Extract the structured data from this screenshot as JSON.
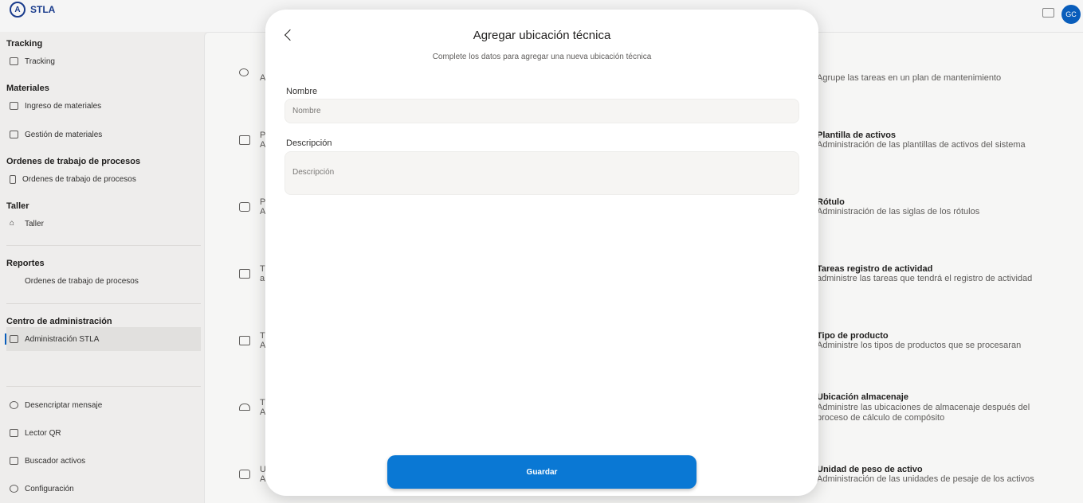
{
  "brand": {
    "logo": "A",
    "name": "STLA"
  },
  "header": {
    "avatar_initials": "GC"
  },
  "sidebar": {
    "sections": [
      {
        "title": "Tracking",
        "items": [
          {
            "label": "Tracking"
          }
        ]
      },
      {
        "title": "Materiales",
        "items": [
          {
            "label": "Ingreso de materiales"
          },
          {
            "label": "Gestión de materiales"
          }
        ]
      },
      {
        "title": "Ordenes de trabajo de procesos",
        "items": [
          {
            "label": "Ordenes de trabajo de procesos"
          }
        ]
      },
      {
        "title": "Taller",
        "items": [
          {
            "label": "Taller"
          }
        ]
      },
      {
        "title": "Reportes",
        "items": [
          {
            "label": "Ordenes de trabajo de procesos"
          }
        ]
      },
      {
        "title": "Centro de administración",
        "items": [
          {
            "label": "Administración STLA"
          }
        ]
      }
    ],
    "bottom_items": [
      {
        "label": "Desencriptar mensaje"
      },
      {
        "label": "Lector QR"
      },
      {
        "label": "Buscador activos"
      },
      {
        "label": "Configuración"
      }
    ]
  },
  "main": {
    "left_letters": [
      "A",
      "P",
      "P",
      "T",
      "T",
      "T",
      "U"
    ],
    "left_sub_letters": [
      "A",
      "A",
      "a",
      "A",
      "A",
      "A"
    ],
    "cards": [
      {
        "title": "",
        "desc": "Agrupe las tareas en un plan de mantenimiento"
      },
      {
        "title": "Plantilla de activos",
        "desc": "Administración de las plantillas de activos del sistema"
      },
      {
        "title": "Rótulo",
        "desc": "Administración de las siglas de los rótulos"
      },
      {
        "title": "Tareas registro de actividad",
        "desc": "administre las tareas que tendrá el registro de actividad"
      },
      {
        "title": "Tipo de producto",
        "desc": "Administre los tipos de productos que se procesaran"
      },
      {
        "title": "Ubicación almacenaje",
        "desc": "Administre las ubicaciones de almacenaje después del proceso de cálculo de compósito"
      },
      {
        "title": "Unidad de peso de activo",
        "desc": "Administración de las unidades de pesaje de los activos"
      }
    ]
  },
  "modal": {
    "title": "Agregar ubicación técnica",
    "subtitle": "Complete los datos para agregar una nueva ubicación técnica",
    "name_label": "Nombre",
    "name_placeholder": "Nombre",
    "name_value": "",
    "desc_label": "Descripción",
    "desc_placeholder": "Descripción",
    "desc_value": "",
    "save_label": "Guardar"
  }
}
